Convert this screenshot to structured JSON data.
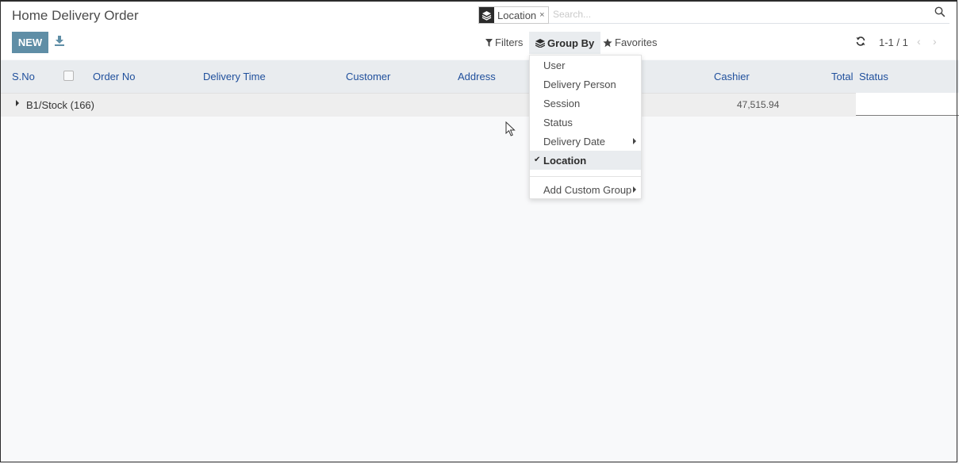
{
  "page": {
    "title": "Home Delivery Order"
  },
  "toolbar": {
    "new_label": "NEW",
    "download_icon": "download-icon"
  },
  "search": {
    "facet_icon": "layers-icon",
    "facet_label": "Location",
    "facet_remove": "×",
    "placeholder": "Search..."
  },
  "filters": {
    "filters_label": "Filters",
    "group_by_label": "Group By",
    "favorites_label": "Favorites"
  },
  "pager": {
    "value": "1-1 / 1",
    "prev": "‹",
    "next": "›"
  },
  "table": {
    "columns": {
      "sno": "S.No",
      "order_no": "Order No",
      "delivery_time": "Delivery Time",
      "customer": "Customer",
      "address": "Address",
      "cashier": "Cashier",
      "total": "Total",
      "status": "Status"
    },
    "groups": [
      {
        "label": "B1/Stock (166)",
        "total": "47,515.94"
      }
    ]
  },
  "group_by_menu": {
    "items": [
      {
        "label": "User",
        "selected": false,
        "submenu": false
      },
      {
        "label": "Delivery Person",
        "selected": false,
        "submenu": false
      },
      {
        "label": "Session",
        "selected": false,
        "submenu": false
      },
      {
        "label": "Status",
        "selected": false,
        "submenu": false
      },
      {
        "label": "Delivery Date",
        "selected": false,
        "submenu": true
      },
      {
        "label": "Location",
        "selected": true,
        "submenu": false
      }
    ],
    "custom_group_label": "Add Custom Group",
    "check_mark": "✔"
  },
  "colors": {
    "accent": "#5f8ea6",
    "header_link": "#1f4f9c",
    "background": "#f8f9fa"
  }
}
